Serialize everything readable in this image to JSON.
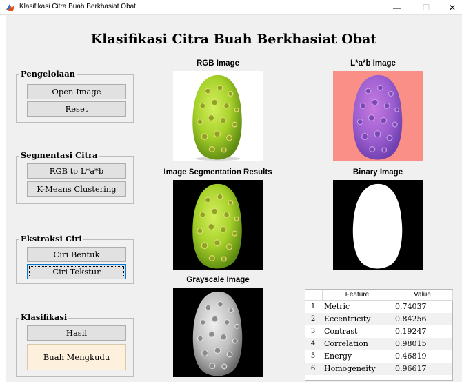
{
  "window": {
    "title": "Klasifikasi Citra Buah Berkhasiat Obat",
    "minimize_symbol": "—",
    "maximize_symbol": "☐",
    "close_symbol": "✕"
  },
  "header": {
    "title": "Klasifikasi Citra Buah Berkhasiat Obat"
  },
  "panels": {
    "pengelolaan": {
      "title": "Pengelolaan",
      "open_label": "Open Image",
      "reset_label": "Reset"
    },
    "segmentasi": {
      "title": "Segmentasi Citra",
      "rgb_lab_label": "RGB to L*a*b",
      "kmeans_label": "K-Means Clustering"
    },
    "ekstraksi": {
      "title": "Ekstraksi Ciri",
      "bentuk_label": "Ciri Bentuk",
      "tekstur_label": "Ciri Tekstur"
    },
    "klasifikasi": {
      "title": "Klasifikasi",
      "hasil_label": "Hasil",
      "result_text": "Buah Mengkudu"
    }
  },
  "images": {
    "rgb_title": "RGB Image",
    "lab_title": "L*a*b Image",
    "segmentation_title": "Image Segmentation Results",
    "binary_title": "Binary Image",
    "grayscale_title": "Grayscale Image"
  },
  "table": {
    "columns": [
      "Feature",
      "Value"
    ],
    "rows": [
      {
        "index": "1",
        "feature": "Metric",
        "value": "0.74037"
      },
      {
        "index": "2",
        "feature": "Eccentricity",
        "value": "0.84256"
      },
      {
        "index": "3",
        "feature": "Contrast",
        "value": "0.19247"
      },
      {
        "index": "4",
        "feature": "Correlation",
        "value": "0.98015"
      },
      {
        "index": "5",
        "feature": "Energy",
        "value": "0.46819"
      },
      {
        "index": "6",
        "feature": "Homogeneity",
        "value": "0.96617"
      }
    ]
  },
  "colors": {
    "window_bg": "#f0f0f0",
    "button_bg": "#e1e1e1",
    "result_bg": "#fdf0dc",
    "lab_bg": "#f98f86",
    "fruit_green": "#a7d32a"
  }
}
